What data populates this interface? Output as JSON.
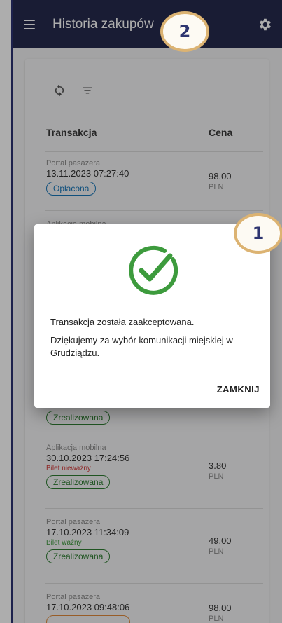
{
  "appbar": {
    "title": "Historia zakupów",
    "menu_icon": "hamburger-icon",
    "settings_icon": "gear-icon"
  },
  "toolbar": {
    "refresh_icon": "refresh-icon",
    "filter_icon": "filter-icon"
  },
  "table": {
    "headers": {
      "transaction": "Transakcja",
      "price": "Cena"
    },
    "rows": [
      {
        "source": "Portal pasażera",
        "date": "13.11.2023 07:27:40",
        "ticket": "",
        "status": "Opłacona",
        "amount": "98.00",
        "currency": "PLN"
      },
      {
        "source": "Aplikacja mobilna",
        "date": "",
        "ticket": "",
        "status": "Zrealizowana",
        "amount": "",
        "currency": ""
      },
      {
        "source": "Aplikacja mobilna",
        "date": "30.10.2023 17:24:56",
        "ticket": "Bilet nieważny",
        "status": "Zrealizowana",
        "amount": "3.80",
        "currency": "PLN"
      },
      {
        "source": "Portal pasażera",
        "date": "17.10.2023 11:34:09",
        "ticket": "Bilet ważny",
        "status": "Zrealizowana",
        "amount": "49.00",
        "currency": "PLN"
      },
      {
        "source": "Portal pasażera",
        "date": "17.10.2023 09:48:06",
        "ticket": "",
        "status": "",
        "amount": "98.00",
        "currency": "PLN"
      }
    ]
  },
  "dialog": {
    "icon": "check-circle-icon",
    "line1": "Transakcja została zaakceptowana.",
    "line2": "Dziękujemy za wybór komunikacji miejskiej w Grudziądzu.",
    "close_label": "ZAMKNIJ"
  },
  "markers": {
    "one": "1",
    "two": "2"
  },
  "colors": {
    "appbar": "#262a4d",
    "success": "#3d9b3d",
    "paid": "#1976b8",
    "done": "#2e7d32",
    "marker_border": "#dcb372"
  }
}
